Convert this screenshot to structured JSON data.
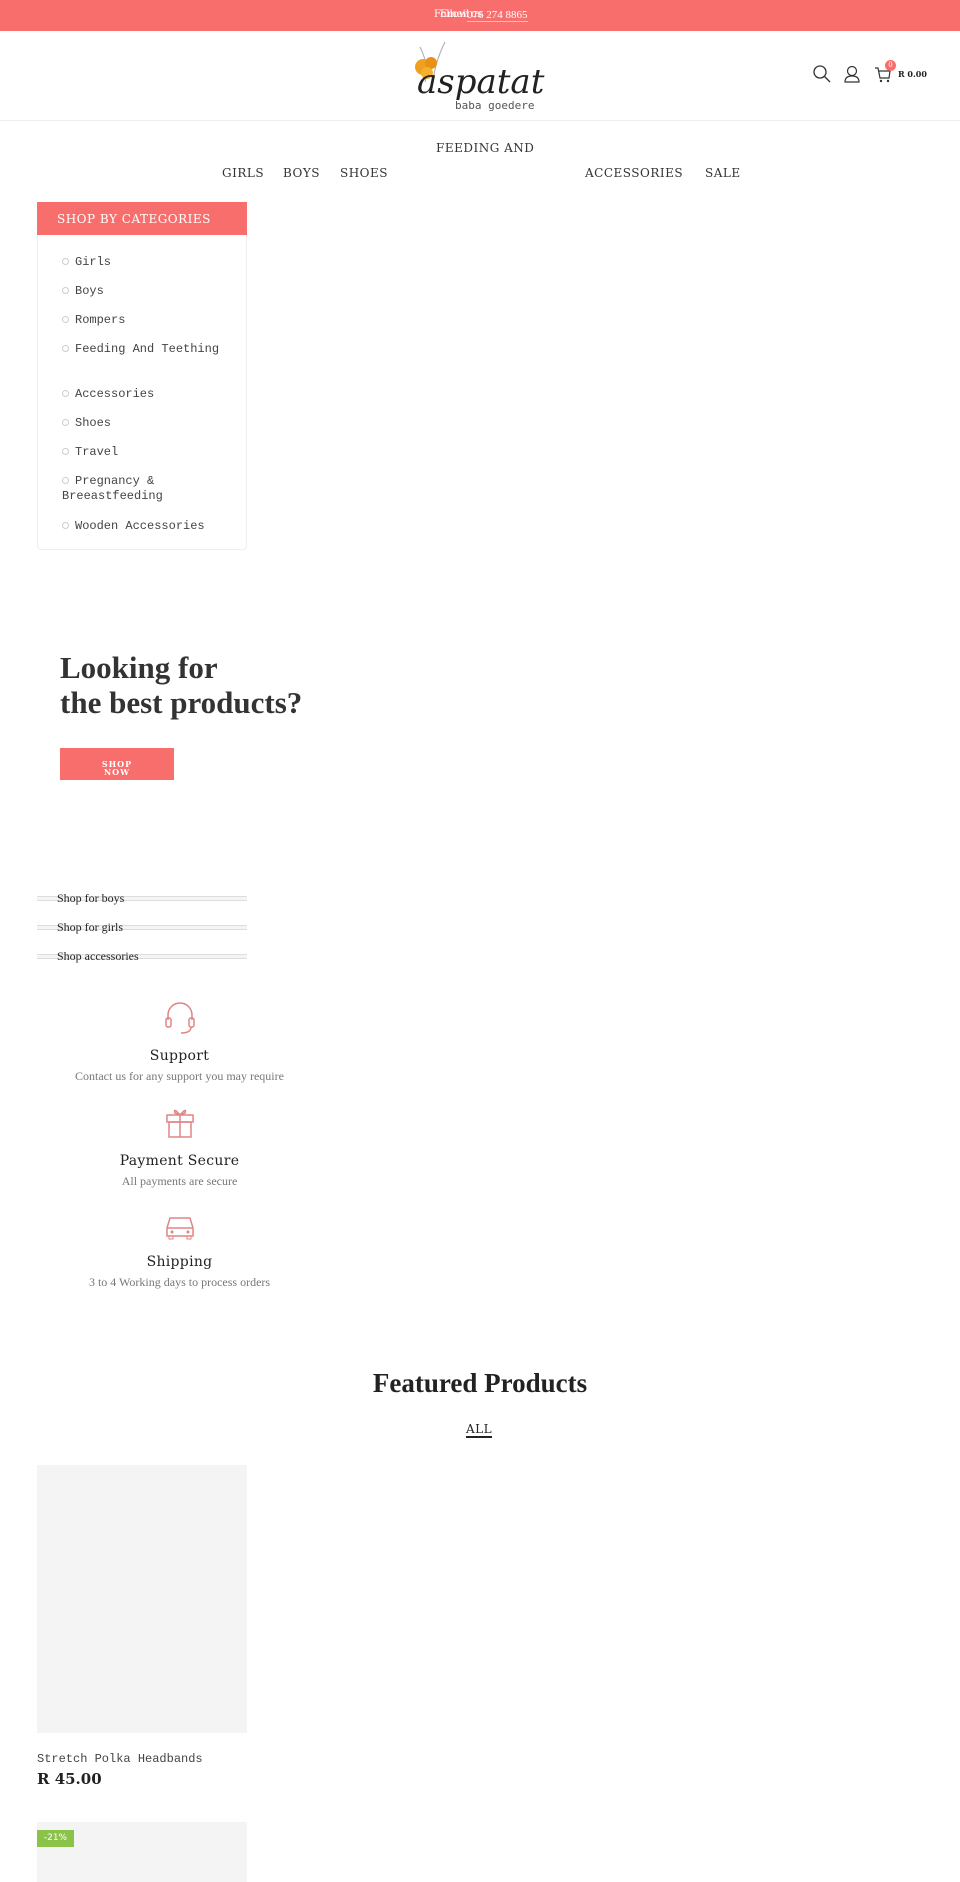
{
  "topbar": {
    "follow": "Follow us",
    "email": "Email",
    "phone": "076 274 8865"
  },
  "header": {
    "logo_text": "aspatat",
    "logo_sub": "baba goedere",
    "cart_count": "0",
    "cart_total": "R 0.00"
  },
  "nav": {
    "items": [
      "GIRLS",
      "BOYS",
      "SHOES",
      "FEEDING AND",
      "ACCESSORIES",
      "SALE"
    ]
  },
  "sidebar": {
    "title": "SHOP BY CATEGORIES",
    "items": [
      "Girls",
      "Boys",
      "Rompers",
      "Feeding And Teething",
      "Accessories",
      "Shoes",
      "Travel",
      "Pregnancy & Breeastfeeding",
      "Wooden Accessories"
    ]
  },
  "hero": {
    "line1": "Looking for",
    "line2": "the best products?",
    "button": "SHOP NOW"
  },
  "shop_links": [
    "Shop for boys",
    "Shop for girls",
    "Shop accessories"
  ],
  "features": [
    {
      "icon": "headset-icon",
      "title": "Support",
      "text": "Contact us for any support you may require"
    },
    {
      "icon": "gift-icon",
      "title": "Payment Secure",
      "text": "All payments are secure"
    },
    {
      "icon": "car-icon",
      "title": "Shipping",
      "text": "3 to 4 Working days to process orders"
    }
  ],
  "featured": {
    "title": "Featured Products",
    "tab": "ALL",
    "products": [
      {
        "name": "Stretch Polka Headbands",
        "price": "R 45.00"
      },
      {
        "badge": "-21%"
      }
    ]
  },
  "colors": {
    "accent": "#f76e6c",
    "badge": "#8bc34a",
    "icon": "#e08585"
  }
}
